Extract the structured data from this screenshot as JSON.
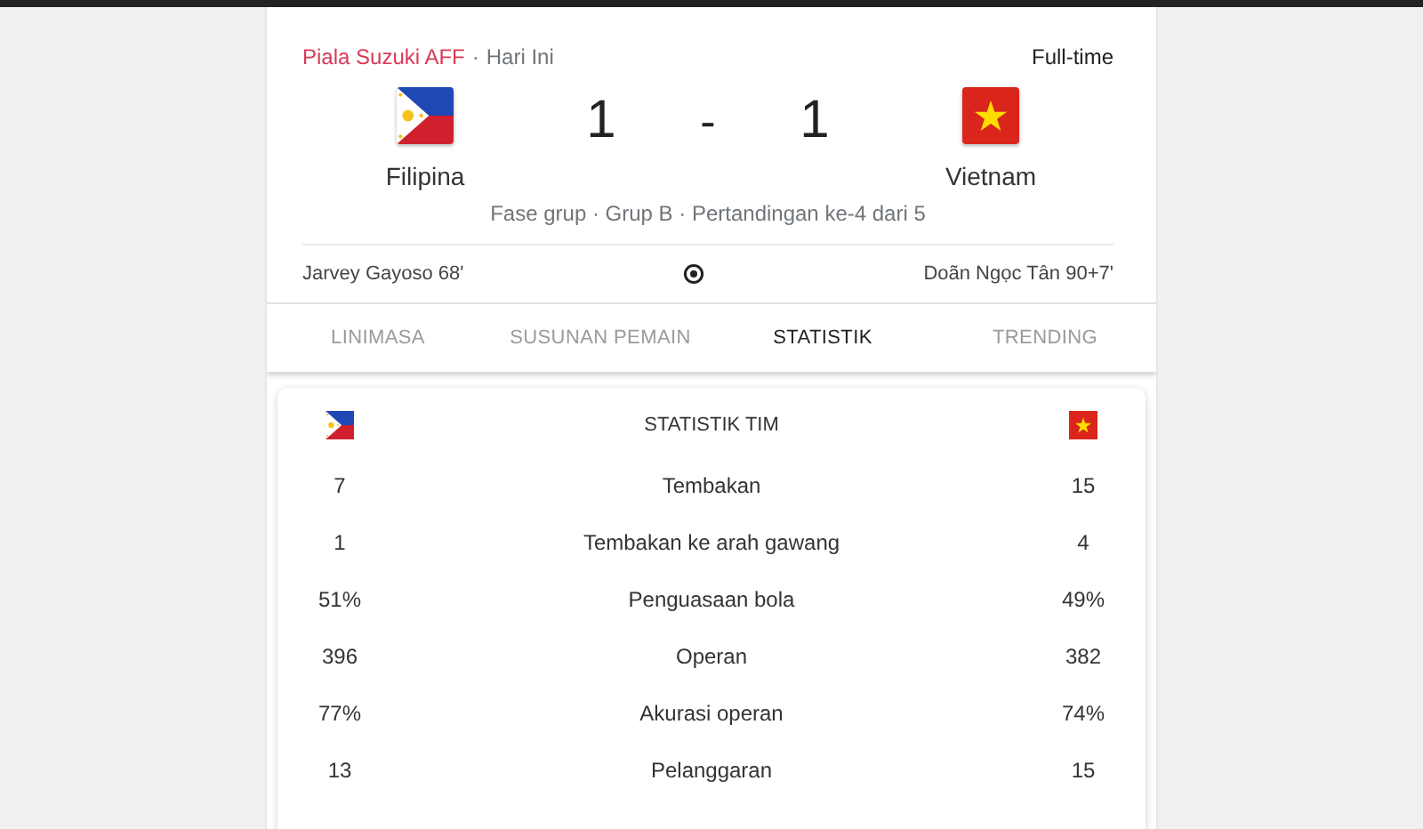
{
  "header": {
    "competition": "Piala Suzuki AFF",
    "separator": "·",
    "date": "Hari Ini",
    "status": "Full-time"
  },
  "teams": [
    {
      "name": "Filipina",
      "score": "1"
    },
    {
      "name": "Vietnam",
      "score": "1"
    }
  ],
  "score_separator": "-",
  "match_info": "Fase grup · Grup B · Pertandingan ke-4 dari 5",
  "scorers": {
    "home": "Jarvey Gayoso 68'",
    "away": "Doãn Ngọc Tân 90+7'"
  },
  "tabs": [
    {
      "label": "LINIMASA",
      "selected": false
    },
    {
      "label": "SUSUNAN PEMAIN",
      "selected": false
    },
    {
      "label": "STATISTIK",
      "selected": true
    },
    {
      "label": "TRENDING",
      "selected": false
    }
  ],
  "stats_title": "STATISTIK TIM",
  "stats": [
    {
      "home": "7",
      "label": "Tembakan",
      "away": "15"
    },
    {
      "home": "1",
      "label": "Tembakan ke arah gawang",
      "away": "4"
    },
    {
      "home": "51%",
      "label": "Penguasaan bola",
      "away": "49%"
    },
    {
      "home": "396",
      "label": "Operan",
      "away": "382"
    },
    {
      "home": "77%",
      "label": "Akurasi operan",
      "away": "74%"
    },
    {
      "home": "13",
      "label": "Pelanggaran",
      "away": "15"
    }
  ]
}
